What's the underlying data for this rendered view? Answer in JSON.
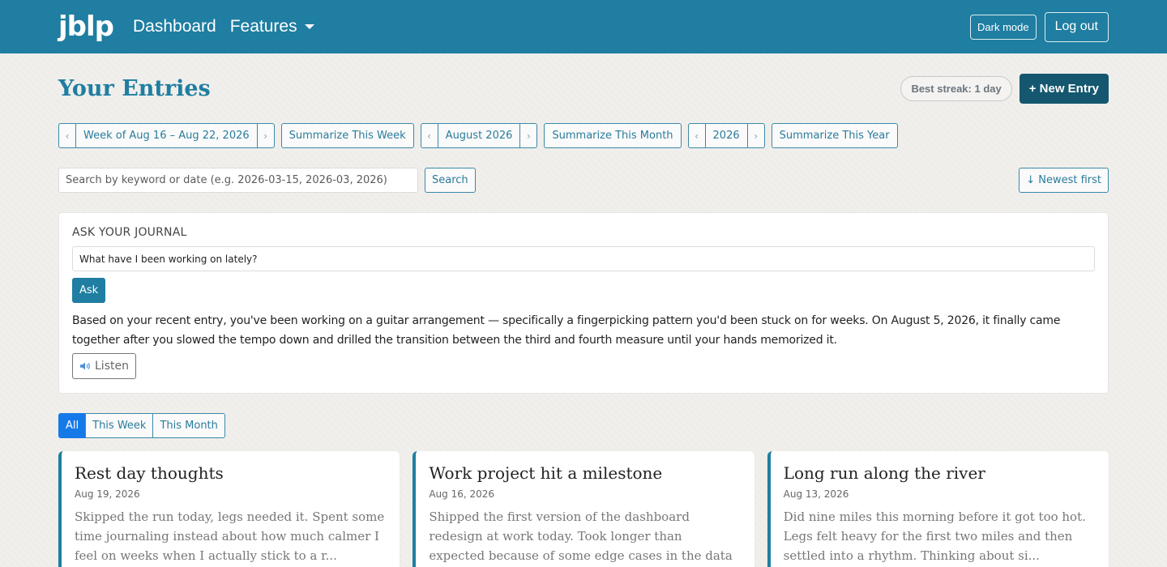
{
  "nav": {
    "logo": "jblp",
    "dashboard": "Dashboard",
    "features": "Features",
    "dark_mode": "Dark mode",
    "logout": "Log out"
  },
  "header": {
    "title": "Your Entries",
    "streak": "Best streak: 1 day",
    "new_entry": "+ New Entry"
  },
  "periods": {
    "prev": "‹",
    "next": "›",
    "week_label": "Week of Aug 16 – Aug 22, 2026",
    "summarize_week": "Summarize This Week",
    "month_label": "August 2026",
    "summarize_month": "Summarize This Month",
    "year_label": "2026",
    "summarize_year": "Summarize This Year"
  },
  "search": {
    "placeholder": "Search by keyword or date (e.g. 2026-03-15, 2026-03, 2026)",
    "button": "Search",
    "sort": "↓ Newest first"
  },
  "ask": {
    "title": "ASK YOUR JOURNAL",
    "question": "What have I been working on lately?",
    "button": "Ask",
    "answer": "Based on your recent entry, you've been working on a guitar arrangement — specifically a fingerpicking pattern you'd been stuck on for weeks. On August 5, 2026, it finally came together after you slowed the tempo down and drilled the transition between the third and fourth measure until your hands memorized it.",
    "listen": "Listen",
    "listen_icon": "speaker-icon"
  },
  "filters": [
    "All",
    "This Week",
    "This Month"
  ],
  "entries": [
    {
      "title": "Rest day thoughts",
      "date": "Aug 19, 2026",
      "excerpt": "Skipped the run today, legs needed it. Spent some time journaling instead about how much calmer I feel on weeks when I actually stick to a r..."
    },
    {
      "title": "Work project hit a milestone",
      "date": "Aug 16, 2026",
      "excerpt": "Shipped the first version of the dashboard redesign at work today. Took longer than expected because of some edge cases in the data layer, b..."
    },
    {
      "title": "Long run along the river",
      "date": "Aug 13, 2026",
      "excerpt": "Did nine miles this morning before it got too hot. Legs felt heavy for the first two miles and then settled into a rhythm. Thinking about si..."
    }
  ],
  "colors": {
    "primary": "#1f7ea1",
    "primary_dark": "#15576f",
    "active_filter": "#1679e8"
  }
}
